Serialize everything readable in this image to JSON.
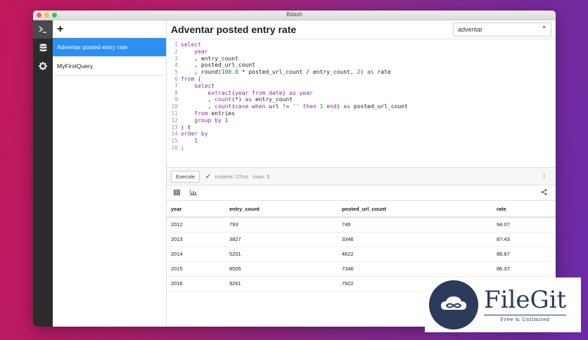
{
  "window": {
    "title": "Bdash"
  },
  "sidebar": {
    "add_icon": "plus-icon",
    "items": [
      {
        "label": "Adventar posted entry rate",
        "active": true
      },
      {
        "label": "MyFirstQuery",
        "active": false
      }
    ]
  },
  "iconbar": {
    "items": [
      {
        "icon": "terminal-icon",
        "active": true
      },
      {
        "icon": "database-icon",
        "active": false
      },
      {
        "icon": "gear-icon",
        "active": false
      }
    ]
  },
  "query": {
    "title": "Adventar posted entry rate",
    "datasource": "adventar",
    "line_numbers": [
      "1",
      "2",
      "3",
      "4",
      "5",
      "6",
      "7",
      "8",
      "9",
      "10",
      "11",
      "12",
      "13",
      "14",
      "15",
      "16"
    ]
  },
  "execution": {
    "button": "Execute",
    "runtime": "runtime: 27ms",
    "rows": "rows: 5"
  },
  "result": {
    "columns": [
      "year",
      "entry_count",
      "posted_url_count",
      "rate"
    ],
    "rows": [
      [
        "2012",
        "793",
        "746",
        "94.07"
      ],
      [
        "2013",
        "3827",
        "3346",
        "87.43"
      ],
      [
        "2014",
        "5201",
        "4622",
        "88.87"
      ],
      [
        "2015",
        "8505",
        "7346",
        "86.37"
      ],
      [
        "2016",
        "9261",
        "7922",
        ""
      ]
    ]
  },
  "watermark": {
    "name": "FileGit",
    "tagline": "Free & Unlimited"
  },
  "colors": {
    "accent": "#2d8ff0",
    "iconbar": "#2b2b2b",
    "success": "#2e9d3a"
  }
}
